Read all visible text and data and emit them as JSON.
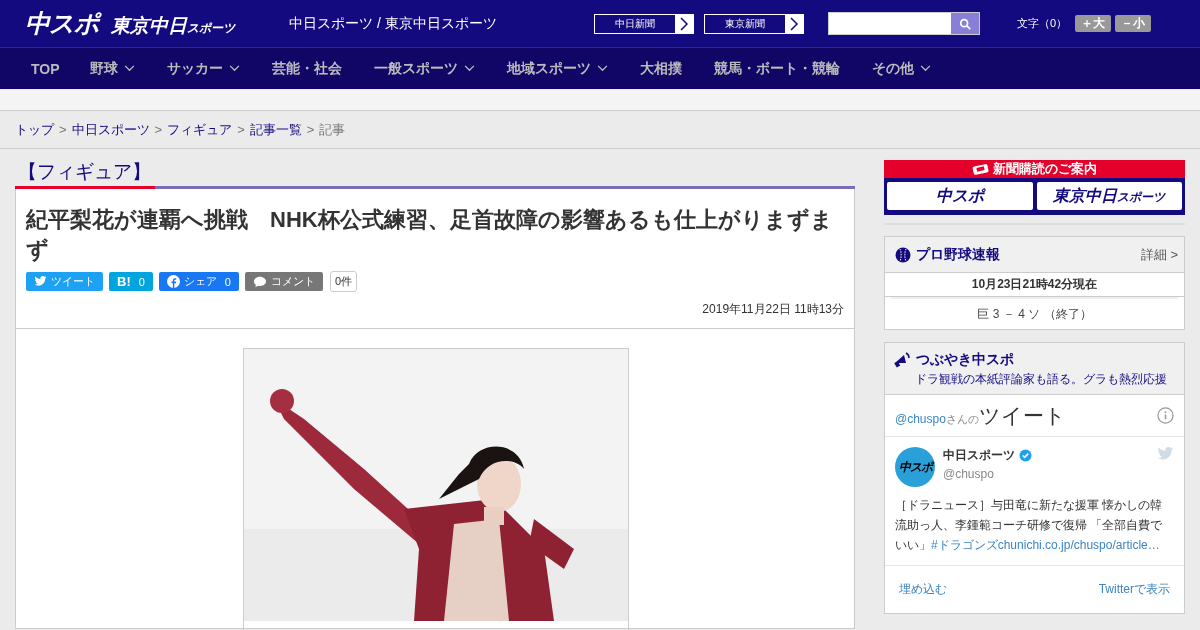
{
  "header": {
    "logo_main": "中スポ",
    "logo_sub": "東京中日",
    "logo_sub_small": "スポーツ",
    "site_title": "中日スポーツ / 東京中日スポーツ",
    "site_links": [
      {
        "label": "中日新聞"
      },
      {
        "label": "東京新聞"
      }
    ],
    "font_size": {
      "label": "文字（0）",
      "buttons": [
        "＋大",
        "－小"
      ]
    }
  },
  "nav": [
    {
      "label": "TOP",
      "has_menu": false
    },
    {
      "label": "野球",
      "has_menu": true
    },
    {
      "label": "サッカー",
      "has_menu": true
    },
    {
      "label": "芸能・社会",
      "has_menu": false
    },
    {
      "label": "一般スポーツ",
      "has_menu": true
    },
    {
      "label": "地域スポーツ",
      "has_menu": true
    },
    {
      "label": "大相撲",
      "has_menu": false
    },
    {
      "label": "競馬・ボート・競輪",
      "has_menu": false
    },
    {
      "label": "その他",
      "has_menu": true
    }
  ],
  "breadcrumb": [
    {
      "label": "トップ",
      "link": true
    },
    {
      "sep": ">",
      "label": "中日スポーツ",
      "link": true
    },
    {
      "sep": ">",
      "label": "フィギュア",
      "link": true
    },
    {
      "sep": ">",
      "label": "記事一覧",
      "link": true
    },
    {
      "sep": ">",
      "label": "記事",
      "link": false
    }
  ],
  "article": {
    "category": "【フィギュア】",
    "title": "紀平梨花が連覇へ挑戦　NHK杯公式練習、足首故障の影響あるも仕上がりまずまず",
    "share": [
      {
        "kind": "twitter",
        "label": "ツイート"
      },
      {
        "kind": "hatena",
        "label": "B!",
        "count": "0"
      },
      {
        "kind": "facebook",
        "label": "シェア",
        "count": "0"
      },
      {
        "kind": "comment",
        "label": "コメント"
      }
    ],
    "comment_count": "0件",
    "date": "2019年11月22日 11時13分"
  },
  "sidebar": {
    "subscribe": {
      "title": "新聞購読のご案内",
      "papers": [
        "中スポ",
        "東京中日"
      ],
      "paper_sub": "スポーツ"
    },
    "baseball": {
      "title": "プロ野球速報",
      "more": "詳細 >",
      "updated": "10月23日21時42分現在",
      "score": "巨 3 － 4 ソ （終了）"
    },
    "tweets": {
      "title": "つぶやき中スポ",
      "subtitle": "ドラ観戦の本紙評論家も語る。グラも熱烈応援",
      "handle": "@chuspo",
      "handle_suffix": "さんの",
      "heading": "ツイート",
      "tweet": {
        "avatar": "中スポ",
        "name": "中日スポーツ",
        "verified": true,
        "user": "@chuspo",
        "text": "［ドラニュース］与田竜に新たな援軍 懐かしの韓流助っ人、李鍾範コーチ研修で復帰 「全部自費でいい」",
        "hashtag": "#ドラゴンズ",
        "url": "chunichi.co.jp/chuspo/article…"
      },
      "embed": "埋め込む",
      "view": "Twitterで表示"
    }
  }
}
